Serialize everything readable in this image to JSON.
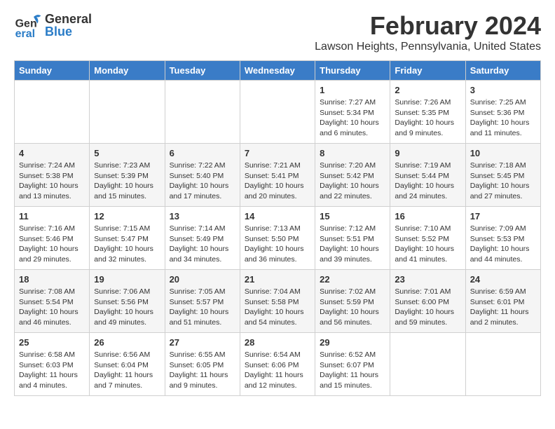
{
  "header": {
    "logo_general": "General",
    "logo_blue": "Blue",
    "title": "February 2024",
    "subtitle": "Lawson Heights, Pennsylvania, United States"
  },
  "days_of_week": [
    "Sunday",
    "Monday",
    "Tuesday",
    "Wednesday",
    "Thursday",
    "Friday",
    "Saturday"
  ],
  "weeks": [
    [
      {
        "day": "",
        "info": ""
      },
      {
        "day": "",
        "info": ""
      },
      {
        "day": "",
        "info": ""
      },
      {
        "day": "",
        "info": ""
      },
      {
        "day": "1",
        "info": "Sunrise: 7:27 AM\nSunset: 5:34 PM\nDaylight: 10 hours\nand 6 minutes."
      },
      {
        "day": "2",
        "info": "Sunrise: 7:26 AM\nSunset: 5:35 PM\nDaylight: 10 hours\nand 9 minutes."
      },
      {
        "day": "3",
        "info": "Sunrise: 7:25 AM\nSunset: 5:36 PM\nDaylight: 10 hours\nand 11 minutes."
      }
    ],
    [
      {
        "day": "4",
        "info": "Sunrise: 7:24 AM\nSunset: 5:38 PM\nDaylight: 10 hours\nand 13 minutes."
      },
      {
        "day": "5",
        "info": "Sunrise: 7:23 AM\nSunset: 5:39 PM\nDaylight: 10 hours\nand 15 minutes."
      },
      {
        "day": "6",
        "info": "Sunrise: 7:22 AM\nSunset: 5:40 PM\nDaylight: 10 hours\nand 17 minutes."
      },
      {
        "day": "7",
        "info": "Sunrise: 7:21 AM\nSunset: 5:41 PM\nDaylight: 10 hours\nand 20 minutes."
      },
      {
        "day": "8",
        "info": "Sunrise: 7:20 AM\nSunset: 5:42 PM\nDaylight: 10 hours\nand 22 minutes."
      },
      {
        "day": "9",
        "info": "Sunrise: 7:19 AM\nSunset: 5:44 PM\nDaylight: 10 hours\nand 24 minutes."
      },
      {
        "day": "10",
        "info": "Sunrise: 7:18 AM\nSunset: 5:45 PM\nDaylight: 10 hours\nand 27 minutes."
      }
    ],
    [
      {
        "day": "11",
        "info": "Sunrise: 7:16 AM\nSunset: 5:46 PM\nDaylight: 10 hours\nand 29 minutes."
      },
      {
        "day": "12",
        "info": "Sunrise: 7:15 AM\nSunset: 5:47 PM\nDaylight: 10 hours\nand 32 minutes."
      },
      {
        "day": "13",
        "info": "Sunrise: 7:14 AM\nSunset: 5:49 PM\nDaylight: 10 hours\nand 34 minutes."
      },
      {
        "day": "14",
        "info": "Sunrise: 7:13 AM\nSunset: 5:50 PM\nDaylight: 10 hours\nand 36 minutes."
      },
      {
        "day": "15",
        "info": "Sunrise: 7:12 AM\nSunset: 5:51 PM\nDaylight: 10 hours\nand 39 minutes."
      },
      {
        "day": "16",
        "info": "Sunrise: 7:10 AM\nSunset: 5:52 PM\nDaylight: 10 hours\nand 41 minutes."
      },
      {
        "day": "17",
        "info": "Sunrise: 7:09 AM\nSunset: 5:53 PM\nDaylight: 10 hours\nand 44 minutes."
      }
    ],
    [
      {
        "day": "18",
        "info": "Sunrise: 7:08 AM\nSunset: 5:54 PM\nDaylight: 10 hours\nand 46 minutes."
      },
      {
        "day": "19",
        "info": "Sunrise: 7:06 AM\nSunset: 5:56 PM\nDaylight: 10 hours\nand 49 minutes."
      },
      {
        "day": "20",
        "info": "Sunrise: 7:05 AM\nSunset: 5:57 PM\nDaylight: 10 hours\nand 51 minutes."
      },
      {
        "day": "21",
        "info": "Sunrise: 7:04 AM\nSunset: 5:58 PM\nDaylight: 10 hours\nand 54 minutes."
      },
      {
        "day": "22",
        "info": "Sunrise: 7:02 AM\nSunset: 5:59 PM\nDaylight: 10 hours\nand 56 minutes."
      },
      {
        "day": "23",
        "info": "Sunrise: 7:01 AM\nSunset: 6:00 PM\nDaylight: 10 hours\nand 59 minutes."
      },
      {
        "day": "24",
        "info": "Sunrise: 6:59 AM\nSunset: 6:01 PM\nDaylight: 11 hours\nand 2 minutes."
      }
    ],
    [
      {
        "day": "25",
        "info": "Sunrise: 6:58 AM\nSunset: 6:03 PM\nDaylight: 11 hours\nand 4 minutes."
      },
      {
        "day": "26",
        "info": "Sunrise: 6:56 AM\nSunset: 6:04 PM\nDaylight: 11 hours\nand 7 minutes."
      },
      {
        "day": "27",
        "info": "Sunrise: 6:55 AM\nSunset: 6:05 PM\nDaylight: 11 hours\nand 9 minutes."
      },
      {
        "day": "28",
        "info": "Sunrise: 6:54 AM\nSunset: 6:06 PM\nDaylight: 11 hours\nand 12 minutes."
      },
      {
        "day": "29",
        "info": "Sunrise: 6:52 AM\nSunset: 6:07 PM\nDaylight: 11 hours\nand 15 minutes."
      },
      {
        "day": "",
        "info": ""
      },
      {
        "day": "",
        "info": ""
      }
    ]
  ]
}
